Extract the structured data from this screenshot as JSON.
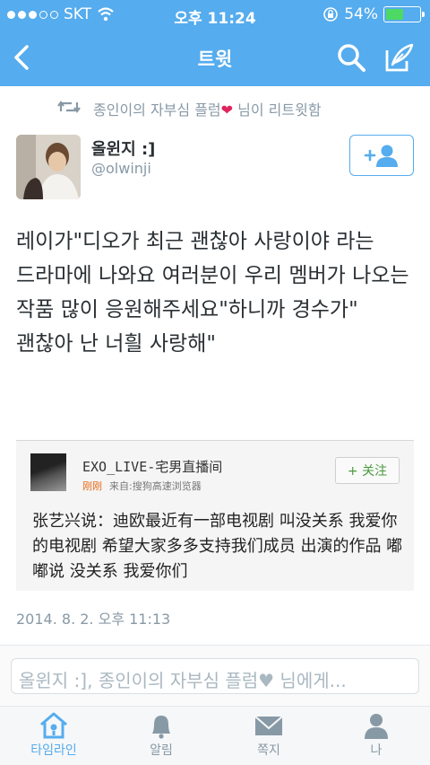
{
  "status": {
    "carrier": "SKT",
    "time": "오후 11:24",
    "battery": "54%",
    "battery_level": 0.54
  },
  "nav": {
    "title": "트윗"
  },
  "retweet": {
    "user": "종인이의 자부심 플럼",
    "suffix": "님이 리트윗함"
  },
  "author": {
    "name": "올윈지 :]",
    "handle": "@olwinji"
  },
  "tweet": {
    "text": "레이가\"디오가 최근 괜찮아 사랑이야 라는 드라마에 나와요 여러분이 우리 멤버가 나오는 작품 많이 응원해주세요\"하니까 경수가\" 괜찮아 난 너흴 사랑해\"",
    "datetime": "2014. 8. 2. 오후 11:13"
  },
  "card": {
    "name": "EXO_LIVE-宅男直播间",
    "time": "刚刚",
    "source": "来自:搜狗高速浏览器",
    "follow": "+ 关注",
    "text": "张艺兴说：迪欧最近有一部电视剧 叫没关系 我爱你的电视剧 希望大家多多支持我们成员 出演的作品 嘟嘟说 没关系 我爱你们"
  },
  "reply": {
    "text": "올윈지 :], 종인이의 자부심 플럼♥ 님에게..."
  },
  "tabs": [
    {
      "label": "타임라인",
      "icon": "home-icon",
      "active": true
    },
    {
      "label": "알림",
      "icon": "bell-icon",
      "active": false
    },
    {
      "label": "쪽지",
      "icon": "envelope-icon",
      "active": false
    },
    {
      "label": "나",
      "icon": "person-icon",
      "active": false
    }
  ],
  "colors": {
    "brand": "#55acee",
    "heart": "#e0245e",
    "battery": "#4cd964"
  }
}
